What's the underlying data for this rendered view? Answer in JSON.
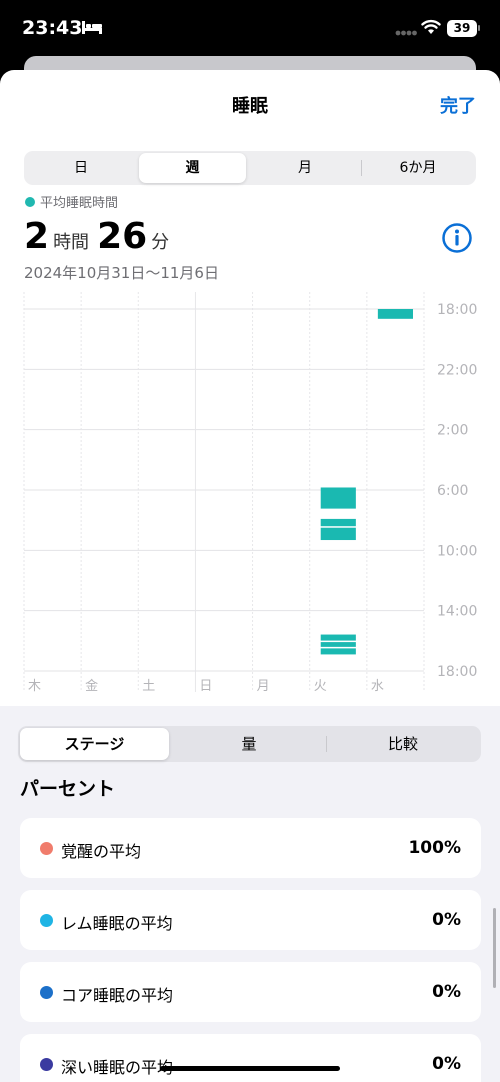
{
  "status_bar": {
    "time": "23:43",
    "battery": "39"
  },
  "nav": {
    "title": "睡眠",
    "done_label": "完了"
  },
  "range_tabs": [
    "日",
    "週",
    "月",
    "6か月"
  ],
  "summary": {
    "legend_label": "平均睡眠時間",
    "hours": "2",
    "hours_unit": "時間",
    "minutes": "26",
    "minutes_unit": "分",
    "date_range": "2024年10月31日〜11月6日"
  },
  "chart_data": {
    "type": "bar",
    "y_tick_labels": [
      "18:00",
      "22:00",
      "2:00",
      "6:00",
      "10:00",
      "14:00",
      "18:00"
    ],
    "y_range_hours_from_18": [
      0,
      24
    ],
    "categories": [
      "木",
      "金",
      "土",
      "日",
      "月",
      "火",
      "水"
    ],
    "segments": [
      {
        "day": "水",
        "start": "18:00",
        "end": "18:45"
      },
      {
        "day": "火",
        "start": "5:50",
        "end": "7:20"
      },
      {
        "day": "火",
        "start": "7:55",
        "end": "8:30"
      },
      {
        "day": "火",
        "start": "8:30",
        "end": "9:25"
      },
      {
        "day": "火",
        "start": "15:35",
        "end": "16:05"
      },
      {
        "day": "火",
        "start": "16:05",
        "end": "16:30"
      },
      {
        "day": "火",
        "start": "16:30",
        "end": "17:00"
      }
    ],
    "bar_color": "#1ab9b1",
    "grid": true
  },
  "detail_tabs": [
    "ステージ",
    "量",
    "比較"
  ],
  "section_title": "パーセント",
  "stages": [
    {
      "label": "覚醒の平均",
      "value": "100%",
      "color": "#f07c6c"
    },
    {
      "label": "レム睡眠の平均",
      "value": "0%",
      "color": "#1fb4e4"
    },
    {
      "label": "コア睡眠の平均",
      "value": "0%",
      "color": "#1c70c9"
    },
    {
      "label": "深い睡眠の平均",
      "value": "0%",
      "color": "#3a3aa0"
    }
  ]
}
